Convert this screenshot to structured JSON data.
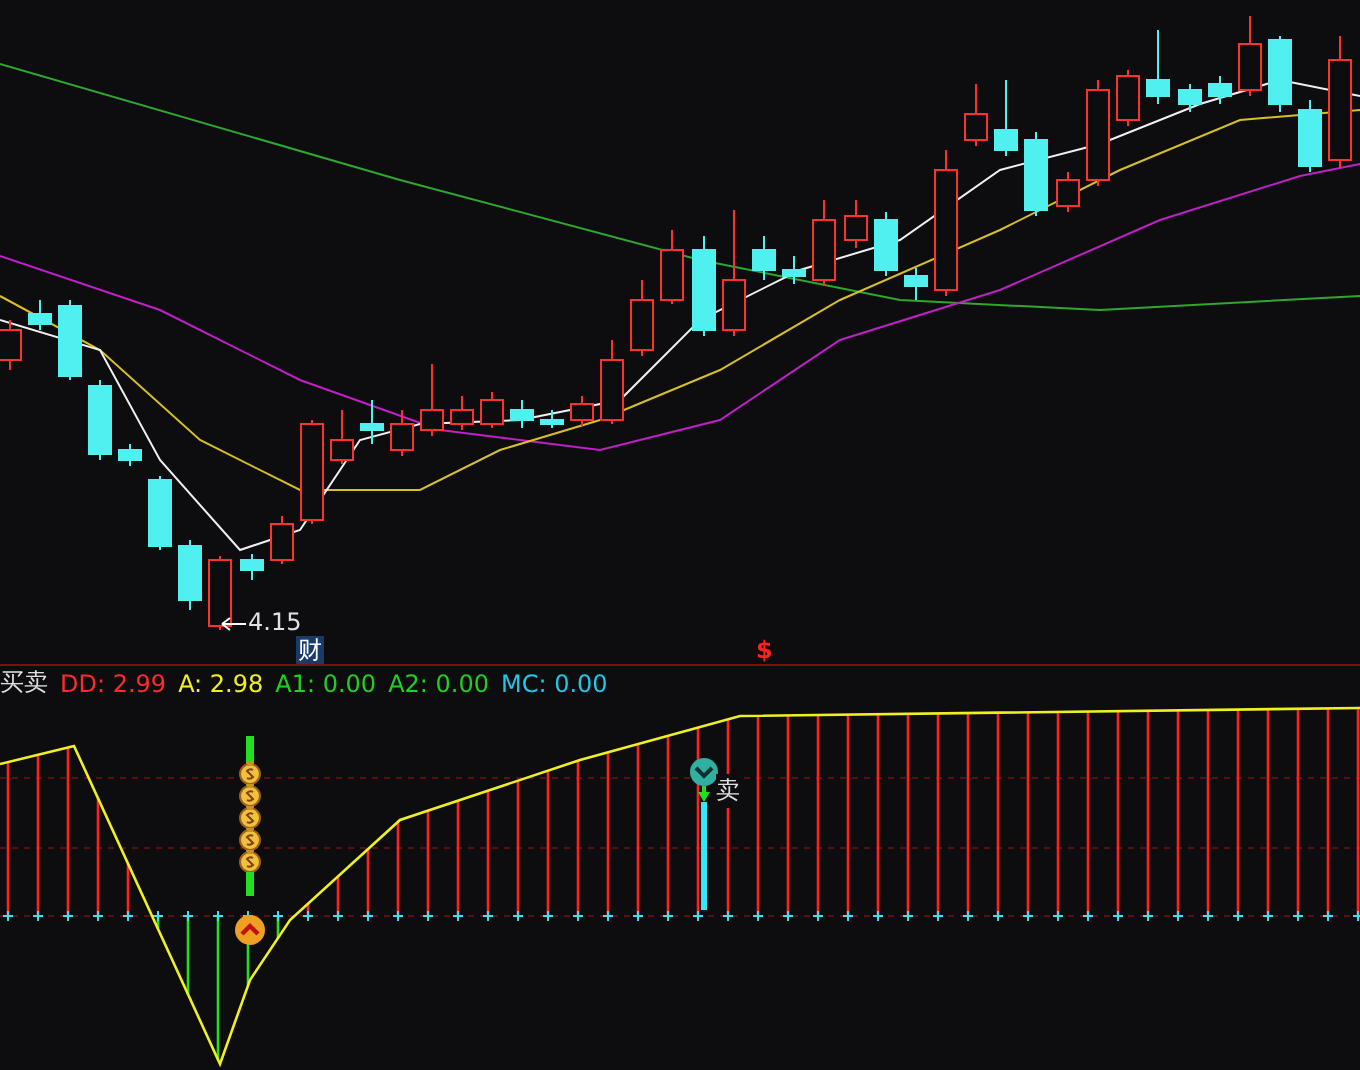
{
  "price_panel": {
    "low_label": "4.15",
    "event_markers": [
      {
        "kind": "finance",
        "text": "财"
      },
      {
        "kind": "dividend",
        "text": "$"
      }
    ]
  },
  "indicator_panel": {
    "name": "买卖",
    "values": [
      {
        "label": "DD: 2.99",
        "color": "#ff2a2a"
      },
      {
        "label": "A: 2.98",
        "color": "#f0f020"
      },
      {
        "label": "A1: 0.00",
        "color": "#20d020"
      },
      {
        "label": "A2: 0.00",
        "color": "#20d020"
      },
      {
        "label": "MC: 0.00",
        "color": "#20c8e8"
      }
    ]
  },
  "signals": [
    {
      "kind": "buy"
    },
    {
      "kind": "sell",
      "text": "卖"
    }
  ]
}
